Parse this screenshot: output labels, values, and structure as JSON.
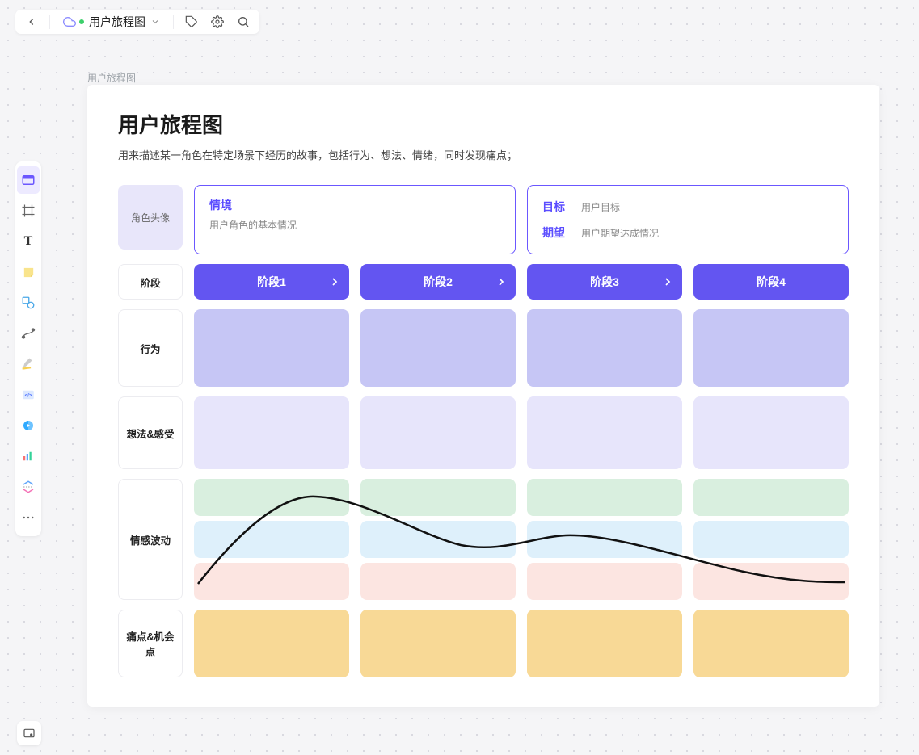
{
  "breadcrumb": "用户旅程图",
  "doc_title": "用户旅程图",
  "canvas": {
    "title": "用户旅程图",
    "subtitle": "用来描述某一角色在特定场景下经历的故事，包括行为、想法、情绪，同时发现痛点；",
    "avatar_label": "角色头像",
    "context": {
      "label": "情境",
      "desc": "用户角色的基本情况"
    },
    "goals": {
      "goal_label": "目标",
      "goal_desc": "用户目标",
      "expect_label": "期望",
      "expect_desc": "用户期望达成情况"
    },
    "rows": {
      "stage": "阶段",
      "behavior": "行为",
      "thought": "想法&感受",
      "emotion": "情感波动",
      "pain": "痛点&机会点"
    },
    "stages": [
      "阶段1",
      "阶段2",
      "阶段3",
      "阶段4"
    ]
  },
  "side_tools": [
    "card",
    "frame",
    "text",
    "sticky",
    "shape",
    "connector",
    "pen",
    "code",
    "disc",
    "chart",
    "collapse",
    "more"
  ]
}
